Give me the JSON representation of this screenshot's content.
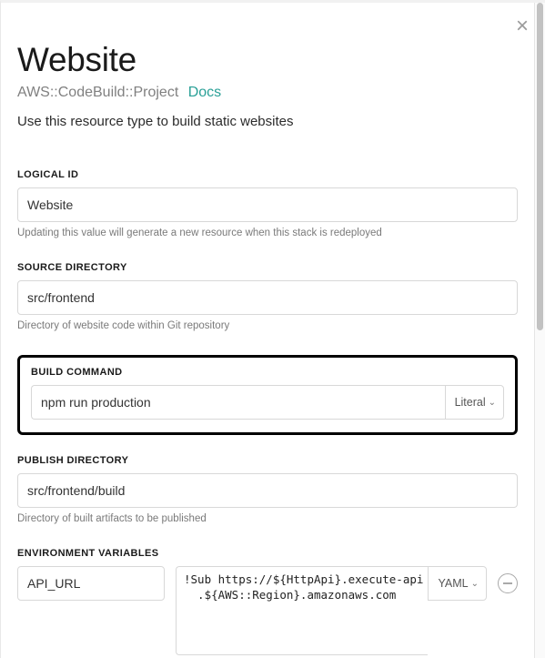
{
  "title": "Website",
  "resource_type": "AWS::CodeBuild::Project",
  "docs_label": "Docs",
  "description": "Use this resource type to build static websites",
  "fields": {
    "logical_id": {
      "label": "LOGICAL ID",
      "value": "Website",
      "help": "Updating this value will generate a new resource when this stack is redeployed"
    },
    "source_directory": {
      "label": "SOURCE DIRECTORY",
      "value": "src/frontend",
      "help": "Directory of website code within Git repository"
    },
    "build_command": {
      "label": "BUILD COMMAND",
      "value": "npm run production",
      "type_label": "Literal"
    },
    "publish_directory": {
      "label": "PUBLISH DIRECTORY",
      "value": "src/frontend/build",
      "help": "Directory of built artifacts to be published"
    },
    "environment_variables": {
      "label": "ENVIRONMENT VARIABLES",
      "rows": [
        {
          "key": "API_URL",
          "value": "!Sub https://${HttpApi}.execute-api\n  .${AWS::Region}.amazonaws.com",
          "type_label": "YAML"
        }
      ]
    }
  }
}
